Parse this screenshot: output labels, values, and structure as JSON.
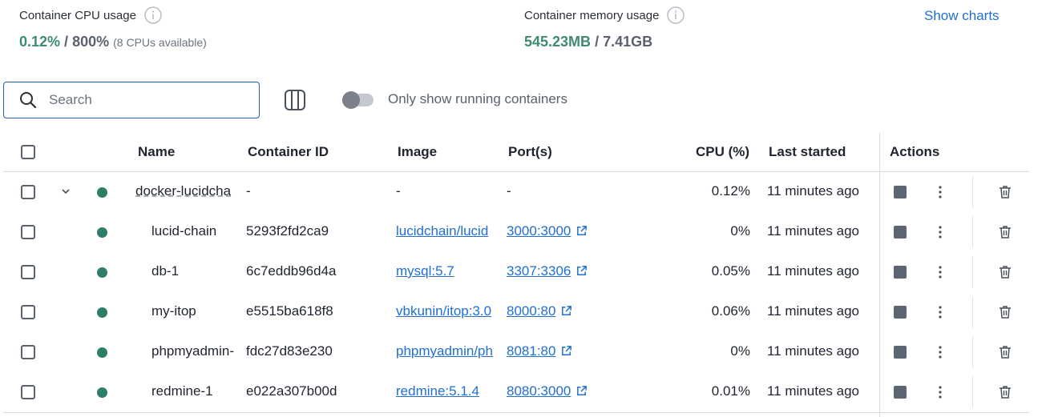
{
  "stats": {
    "cpu_label": "Container CPU usage",
    "cpu_used": "0.12%",
    "cpu_sep": " / ",
    "cpu_total": "800%",
    "cpu_sub": "(8 CPUs available)",
    "mem_label": "Container memory usage",
    "mem_used": "545.23MB",
    "mem_sep": " / ",
    "mem_total": "7.41GB",
    "show_charts": "Show charts"
  },
  "toolbar": {
    "search_placeholder": "Search",
    "toggle_label": "Only show running containers",
    "toggle_on": false
  },
  "table": {
    "headers": {
      "name": "Name",
      "container_id": "Container ID",
      "image": "Image",
      "ports": "Port(s)",
      "cpu": "CPU (%)",
      "last_started": "Last started",
      "actions": "Actions"
    },
    "rows": [
      {
        "name": "docker-lucidcha",
        "id": "-",
        "image": "-",
        "port": "-",
        "cpu": "0.12%",
        "started": "11 minutes ago",
        "group": true
      },
      {
        "name": "lucid-chain",
        "id": "5293f2fd2ca9",
        "image": "lucidchain/lucid",
        "port": "3000:3000",
        "cpu": "0%",
        "started": "11 minutes ago"
      },
      {
        "name": "db-1",
        "id": "6c7eddb96d4a",
        "image": "mysql:5.7",
        "port": "3307:3306",
        "cpu": "0.05%",
        "started": "11 minutes ago"
      },
      {
        "name": "my-itop",
        "id": "e5515ba618f8",
        "image": "vbkunin/itop:3.0",
        "port": "8000:80",
        "cpu": "0.06%",
        "started": "11 minutes ago"
      },
      {
        "name": "phpmyadmin-",
        "id": "fdc27d83e230",
        "image": "phpmyadmin/ph",
        "port": "8081:80",
        "cpu": "0%",
        "started": "11 minutes ago"
      },
      {
        "name": "redmine-1",
        "id": "e022a307b00d",
        "image": "redmine:5.1.4",
        "port": "8080:3000",
        "cpu": "0.01%",
        "started": "11 minutes ago"
      }
    ]
  },
  "colors": {
    "accent": "#1f6fd1",
    "running": "#2e7d68",
    "value_green": "#3f8a72"
  }
}
